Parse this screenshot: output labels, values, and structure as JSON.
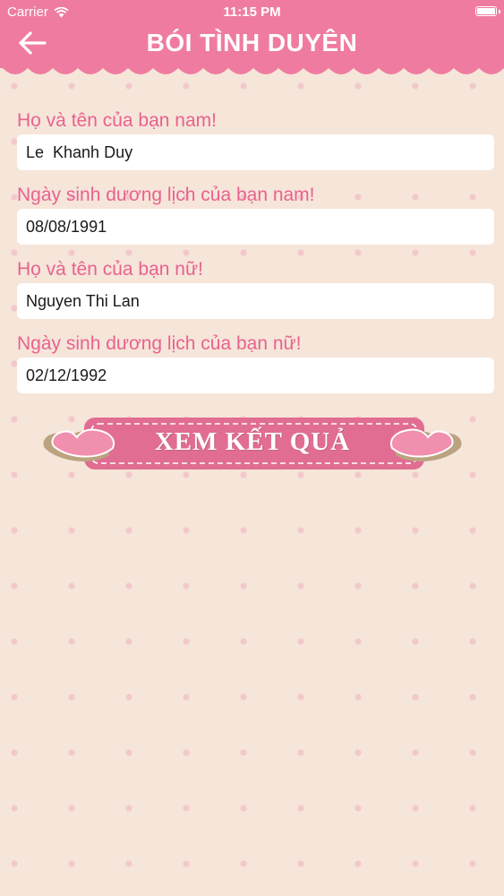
{
  "status_bar": {
    "carrier": "Carrier",
    "time": "11:15 PM",
    "icons": [
      "wifi-icon",
      "battery-icon"
    ]
  },
  "header": {
    "title": "BÓI TÌNH DUYÊN",
    "back_icon": "arrow-left-icon",
    "color": "#ef7ca0"
  },
  "form": {
    "male_name_label": "Họ và tên của bạn nam!",
    "male_name_value": "Le  Khanh Duy",
    "male_birth_label": "Ngày sinh dương lịch của bạn nam!",
    "male_birth_value": "08/08/1991",
    "female_name_label": "Họ và tên của bạn nữ!",
    "female_name_value": "Nguyen Thi Lan",
    "female_birth_label": "Ngày sinh dương lịch của bạn nữ!",
    "female_birth_value": "02/12/1992"
  },
  "submit": {
    "label": "XEM KẾT QUẢ",
    "icons": [
      "heart-left-icon",
      "heart-right-icon"
    ]
  },
  "colors": {
    "background": "#f6e5d9",
    "accent": "#ef7ca0",
    "label_text": "#e8628f"
  }
}
